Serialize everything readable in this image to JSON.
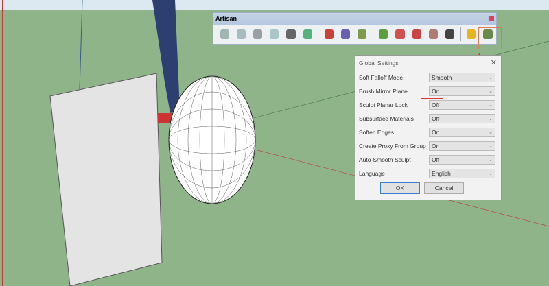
{
  "toolbar": {
    "title": "Artisan",
    "icons": [
      {
        "name": "subdivide-icon",
        "color": "#9fb7b0"
      },
      {
        "name": "smooth-icon",
        "color": "#a8bcc0"
      },
      {
        "name": "crease-icon",
        "color": "#9aa0a4"
      },
      {
        "name": "knife-icon",
        "color": "#a9c6c9"
      },
      {
        "name": "vertex-icon",
        "color": "#666666"
      },
      {
        "name": "organic-icon",
        "color": "#55b27c"
      },
      {
        "name": "sculpt-add-icon",
        "color": "#c9423a"
      },
      {
        "name": "sculpt-pull-icon",
        "color": "#6b5fb0"
      },
      {
        "name": "sculpt-smooth-icon",
        "color": "#7d9a4e"
      },
      {
        "name": "select-icon",
        "color": "#5aa040"
      },
      {
        "name": "soft-select-icon",
        "color": "#d05050"
      },
      {
        "name": "grow-icon",
        "color": "#cc4444"
      },
      {
        "name": "shrink-icon",
        "color": "#b07b70"
      },
      {
        "name": "move-icon",
        "color": "#444444"
      },
      {
        "name": "info-icon",
        "color": "#e9b51f"
      },
      {
        "name": "settings-tools-icon",
        "color": "#6a8a4a"
      }
    ]
  },
  "dialog": {
    "title": "Global Settings",
    "close": "✕",
    "rows": [
      {
        "label": "Soft Falloff Mode",
        "value": "Smooth"
      },
      {
        "label": "Brush Mirror Plane",
        "value": "On"
      },
      {
        "label": "Sculpt Planar Lock",
        "value": "Off"
      },
      {
        "label": "Subsurface Materials",
        "value": "Off"
      },
      {
        "label": "Soften Edges",
        "value": "On"
      },
      {
        "label": "Create Proxy From Group",
        "value": "On"
      },
      {
        "label": "Auto-Smooth Sculpt",
        "value": "Off"
      },
      {
        "label": "Language",
        "value": "English"
      }
    ],
    "ok": "OK",
    "cancel": "Cancel"
  }
}
